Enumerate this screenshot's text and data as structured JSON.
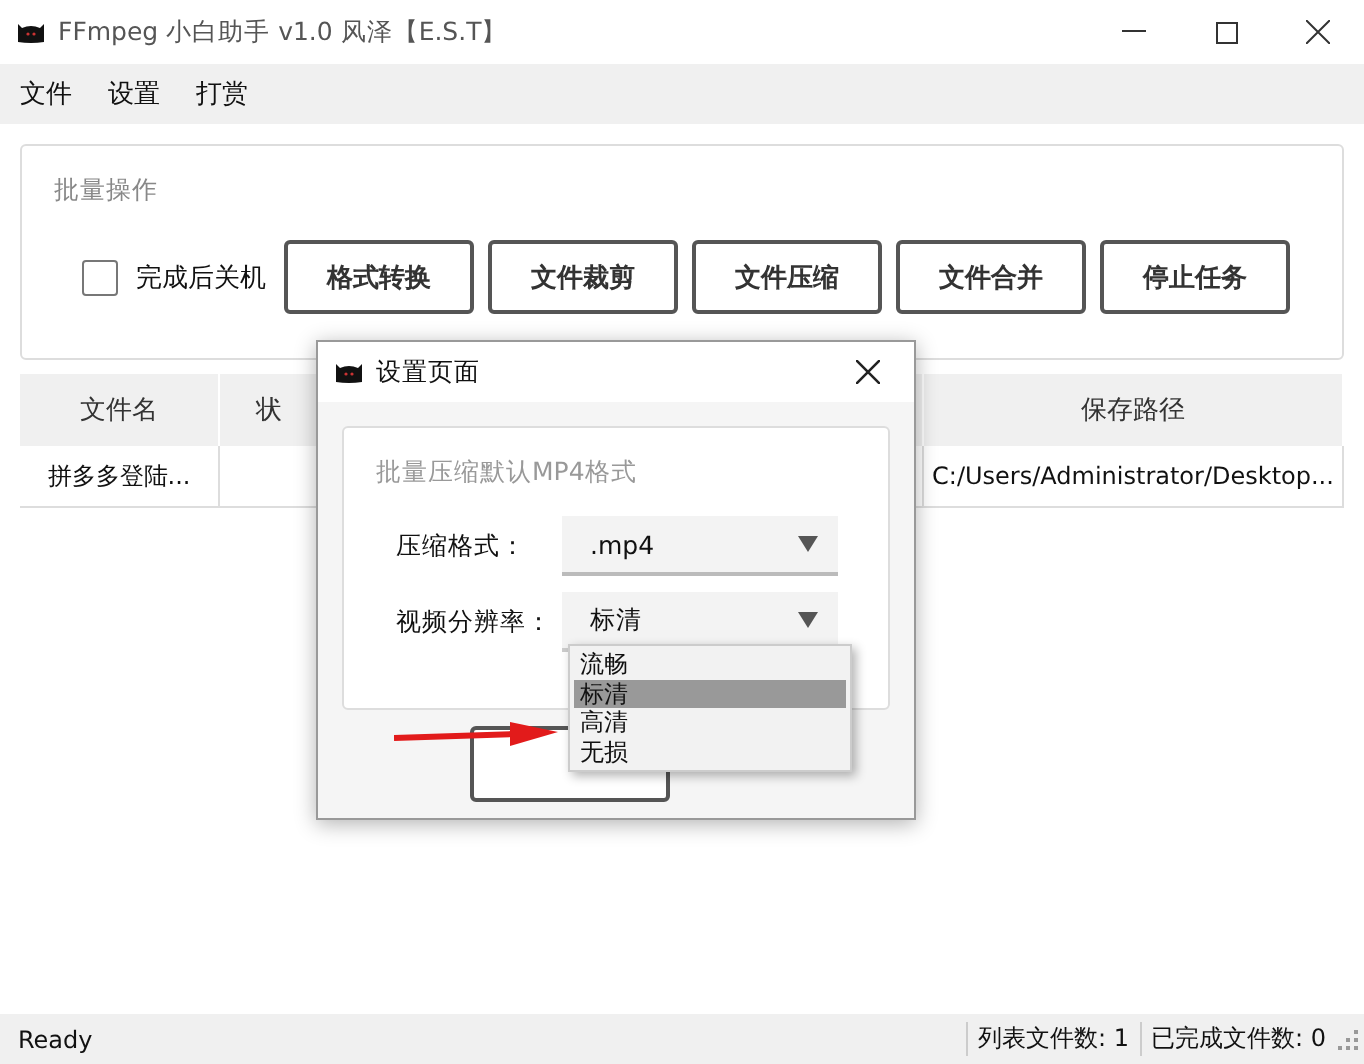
{
  "window": {
    "title": "FFmpeg 小白助手 v1.0 风泽【E.S.T】"
  },
  "menu": [
    "文件",
    "设置",
    "打赏"
  ],
  "batch": {
    "title": "批量操作",
    "shutdown": {
      "label": "完成后关机",
      "checked": false
    },
    "buttons": [
      "格式转换",
      "文件裁剪",
      "文件压缩",
      "文件合并",
      "停止任务"
    ]
  },
  "table": {
    "columns": [
      "文件名",
      "状",
      "保存路径"
    ],
    "rows": [
      {
        "file": "拼多多登陆...",
        "path": "C:/Users/Administrator/Desktop..."
      }
    ]
  },
  "dialog": {
    "title": "设置页面",
    "group_title": "批量压缩默认MP4格式",
    "fields": [
      {
        "label": "压缩格式：",
        "value": ".mp4",
        "expanded": false
      },
      {
        "label": "视频分辨率：",
        "value": "标清",
        "expanded": true
      }
    ],
    "options": [
      {
        "label": "流畅",
        "selected": false
      },
      {
        "label": "标清",
        "selected": true
      },
      {
        "label": "高清",
        "selected": false
      },
      {
        "label": "无损",
        "selected": false
      }
    ]
  },
  "status_bar": {
    "status": "Ready",
    "list_count": "列表文件数: 1",
    "done_count": "已完成文件数: 0"
  }
}
